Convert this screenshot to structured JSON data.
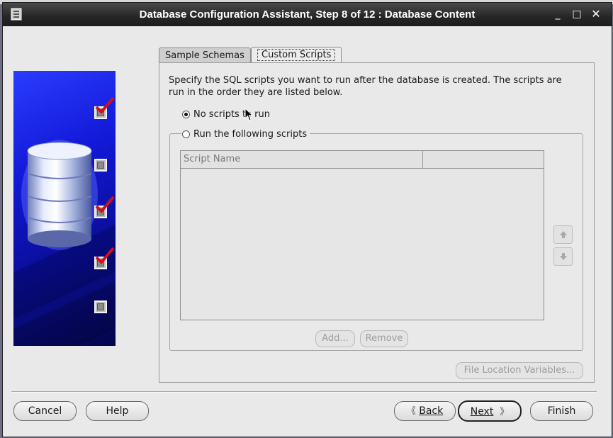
{
  "window": {
    "title": "Database Configuration Assistant, Step 8 of 12 : Database Content",
    "controls": {
      "minimize": "_",
      "maximize": "□",
      "close": "✕"
    }
  },
  "side_panel": {
    "icon": "database-cylinder-icon",
    "steps": [
      {
        "state": "checked"
      },
      {
        "state": "unchecked"
      },
      {
        "state": "checked"
      },
      {
        "state": "checked"
      },
      {
        "state": "unchecked"
      }
    ]
  },
  "tabs": [
    {
      "label": "Sample Schemas",
      "selected": false
    },
    {
      "label": "Custom Scripts",
      "selected": true
    }
  ],
  "content": {
    "description": "Specify the SQL scripts you want to run after the database is created. The scripts are run in the order they are listed below.",
    "option_no_scripts": "No scripts to run",
    "option_run_scripts": "Run the following scripts",
    "selected_option": "no_scripts",
    "table": {
      "columns": [
        "Script Name",
        ""
      ],
      "rows": []
    },
    "move_up_icon": "arrow-up-icon",
    "move_down_icon": "arrow-down-icon",
    "add_label": "Add...",
    "remove_label": "Remove",
    "file_location_label": "File Location Variables..."
  },
  "footer": {
    "cancel_label": "Cancel",
    "help_label": "Help",
    "back_label": "Back",
    "next_label": "Next",
    "finish_label": "Finish"
  },
  "colors": {
    "titlebar": "#262626",
    "window_bg": "#e9e9e9",
    "panel_blue": "#1218d6",
    "check_red": "#d0101a"
  }
}
